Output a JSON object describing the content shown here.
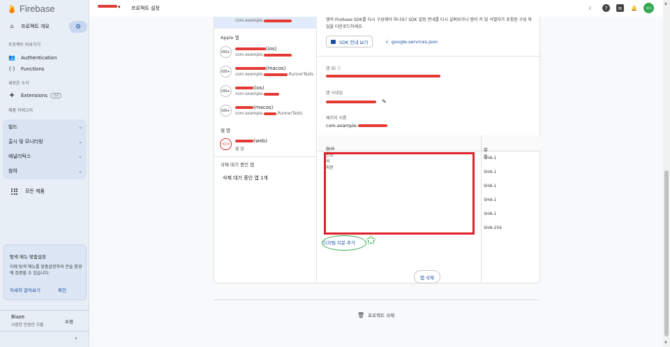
{
  "sidebar": {
    "brand": "Firebase",
    "project_overview": "프로젝트 개요",
    "shortcuts_label": "프로젝트 바로가기",
    "shortcuts": [
      {
        "label": "Authentication",
        "icon": "people-icon"
      },
      {
        "label": "Functions",
        "icon": "functions-icon"
      }
    ],
    "news_label": "새로운 소식",
    "extensions": {
      "label": "Extensions",
      "badge": "신규"
    },
    "categories_label": "제품 카테고리",
    "groups": [
      "빌드",
      "출시 및 모니터링",
      "애널리틱스",
      "참여"
    ],
    "all_products": "모든 제품",
    "tip": {
      "title": "탐색 메뉴 맞춤설정",
      "body": "이제 탐색 메뉴를 맞춤설정하여 콘솔 환경에 집중할 수 있습니다.",
      "learn_more": "자세히 알아보기",
      "confirm": "확인"
    },
    "plan": {
      "name": "Blaze",
      "sub": "사용한 만큼만 지불",
      "edit": "수정"
    }
  },
  "topbar": {
    "page_title": "프로젝트 설정",
    "avatar_text": "리더"
  },
  "apps": {
    "apple_label": "Apple 앱",
    "apple": [
      {
        "name": "(ios)",
        "sub": "com.example.",
        "suffix": "",
        "badge": "iOS+"
      },
      {
        "name": "(macos)",
        "sub": "com.example.",
        "suffix": ".RunnerTests",
        "badge": "iOS+"
      },
      {
        "name": "(ios)",
        "sub": "com.example.",
        "suffix": "",
        "badge": "iOS+"
      },
      {
        "name": "(macos)",
        "sub": "com.example.",
        "suffix": ".RunnerTests",
        "badge": "iOS+"
      }
    ],
    "selected_sub": "com.example.",
    "web_label": "웹 앱",
    "web": {
      "name": "(web)",
      "sub": "웹 앱",
      "badge": "</>"
    },
    "pending_label": "삭제 대기 중인 앱",
    "pending_item": "삭제 대기 중인 앱 1개"
  },
  "detail": {
    "intro": "앱의 Firebase SDK를 다시 구성해야 하나요? SDK 설정 안내를 다시 살펴보거나 앱의 키 및 식별자가 포함된 구성 파일을 다운로드하세요.",
    "sdk_button": "SDK 안내 보기",
    "download_button": "google-services.json",
    "app_id_label": "앱 ID",
    "nickname_label": "앱 닉네임",
    "package_label": "패키지 이름",
    "package_value": "com.example.",
    "sha_label": "SHA 인증서 지문",
    "type_label": "유형",
    "sha_types": [
      "SHA-1",
      "SHA-1",
      "SHA-1",
      "SHA-1",
      "SHA-1",
      "SHA-256"
    ],
    "add_fingerprint": "디지털 지문 추가",
    "delete_app": "앱 삭제"
  },
  "footer": {
    "delete_project": "프로젝트 삭제"
  },
  "colors": {
    "accent": "#1a4fa0",
    "sidebar_bg": "#e8eef6",
    "annotation_red": "#e0202a",
    "annotation_green": "#2aa843"
  }
}
